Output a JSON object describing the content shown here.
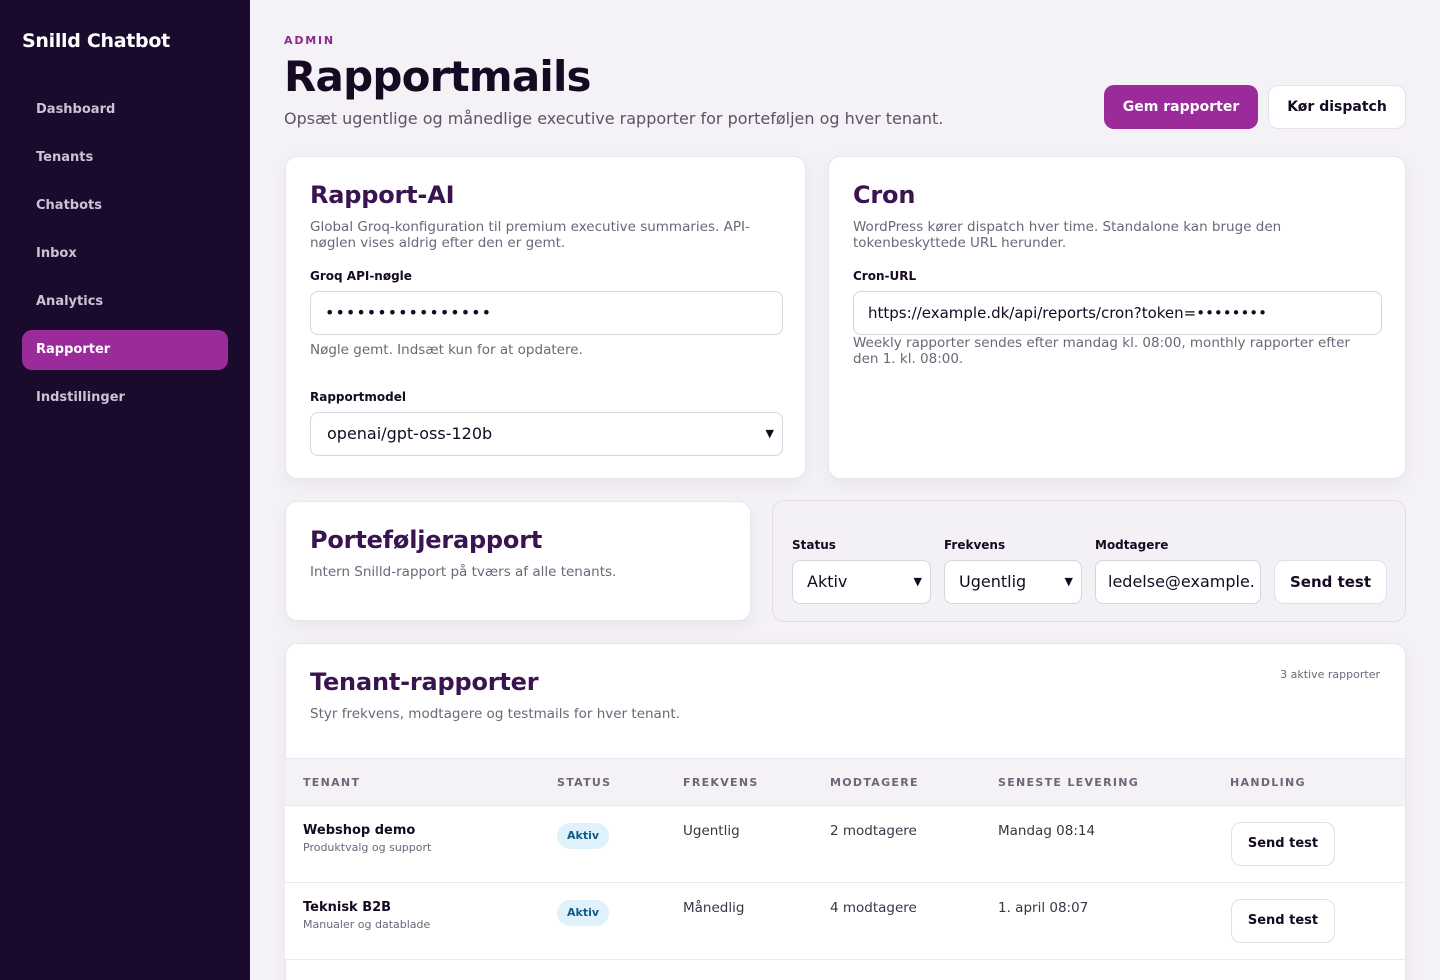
{
  "sidebar": {
    "brand": "Snilld Chatbot",
    "items": [
      {
        "label": "Dashboard"
      },
      {
        "label": "Tenants"
      },
      {
        "label": "Chatbots"
      },
      {
        "label": "Inbox"
      },
      {
        "label": "Analytics"
      },
      {
        "label": "Rapporter",
        "active": true
      },
      {
        "label": "Indstillinger"
      }
    ]
  },
  "header": {
    "eyebrow": "ADMIN",
    "title": "Rapportmails",
    "subtitle": "Opsæt ugentlige og månedlige executive rapporter for porteføljen og hver tenant.",
    "save_label": "Gem rapporter",
    "dispatch_label": "Kør dispatch"
  },
  "ai_card": {
    "title": "Rapport-AI",
    "description": "Global Groq-konfiguration til premium executive summaries. API-nøglen vises aldrig efter den er gemt.",
    "key_label": "Groq API-nøgle",
    "key_value": "••••••••••••••••",
    "key_hint": "Nøgle gemt. Indsæt kun for at opdatere.",
    "model_label": "Rapportmodel",
    "model_value": "openai/gpt-oss-120b"
  },
  "cron_card": {
    "title": "Cron",
    "description": "WordPress kører dispatch hver time. Standalone kan bruge den tokenbeskyttede URL herunder.",
    "url_label": "Cron-URL",
    "url_value": "https://example.dk/api/reports/cron?token=••••••••",
    "hint": "Weekly rapporter sendes efter mandag kl. 08:00, monthly rapporter efter den 1. kl. 08:00."
  },
  "portfolio": {
    "title": "Porteføljerapport",
    "description": "Intern Snilld-rapport på tværs af alle tenants.",
    "status_label": "Status",
    "status_value": "Aktiv",
    "frequency_label": "Frekvens",
    "frequency_value": "Ugentlig",
    "recipients_label": "Modtagere",
    "recipients_value": "ledelse@example.",
    "send_test_label": "Send test"
  },
  "tenants": {
    "title": "Tenant-rapporter",
    "description": "Styr frekvens, modtagere og testmails for hver tenant.",
    "count": "3 aktive rapporter",
    "columns": [
      "TENANT",
      "STATUS",
      "FREKVENS",
      "MODTAGERE",
      "SENESTE LEVERING",
      "HANDLING"
    ],
    "rows": [
      {
        "name": "Webshop demo",
        "desc": "Produktvalg og support",
        "status": "Aktiv",
        "frequency": "Ugentlig",
        "recipients": "2 modtagere",
        "last": "Mandag 08:14",
        "action": "Send test"
      },
      {
        "name": "Teknisk B2B",
        "desc": "Manualer og datablade",
        "status": "Aktiv",
        "frequency": "Månedlig",
        "recipients": "4 modtagere",
        "last": "1. april 08:07",
        "action": "Send test"
      }
    ]
  },
  "colors": {
    "sidebar_bg": "#1a0b2e",
    "accent": "#9b2a9b",
    "badge_bg": "#dff1fb"
  }
}
